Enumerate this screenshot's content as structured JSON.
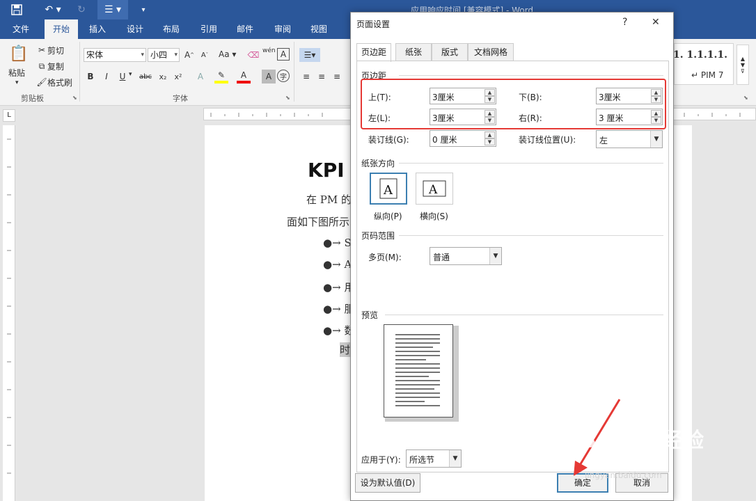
{
  "window": {
    "title": "应用响应时间 [兼容模式] - Word"
  },
  "quick_access": {
    "save_icon": "save-icon",
    "undo_icon": "undo-icon",
    "redo_icon": "redo-icon",
    "list_icon": "bullet-list-icon"
  },
  "ribbon_tabs": [
    "文件",
    "开始",
    "插入",
    "设计",
    "布局",
    "引用",
    "邮件",
    "审阅",
    "视图"
  ],
  "ribbon": {
    "clipboard": {
      "label": "剪贴板",
      "paste": "粘贴",
      "cut": "剪切",
      "copy": "复制",
      "format_painter": "格式刷"
    },
    "font": {
      "label": "字体",
      "font_name": "宋体",
      "font_size": "小四",
      "aa": "Aa",
      "wen": "wén",
      "a_box": "A"
    },
    "styles": {
      "style1": "1.  1.1.1.1.",
      "style2": "↵ PIM 7"
    }
  },
  "document": {
    "heading": "KPI",
    "line1": "在 PM 的",
    "line2": "面如下图所示",
    "bullets": [
      "Se",
      "Av",
      "用",
      "服",
      "数"
    ],
    "last": "时"
  },
  "dialog": {
    "title": "页面设置",
    "help": "?",
    "close": "✕",
    "tabs": [
      "页边距",
      "纸张",
      "版式",
      "文档网格"
    ],
    "margins_section": "页边距",
    "top_label": "上(T):",
    "top_value": "3厘米",
    "bottom_label": "下(B):",
    "bottom_value": "3厘米",
    "left_label": "左(L):",
    "left_value": "3厘米",
    "right_label": "右(R):",
    "right_value": "3 厘米",
    "gutter_label": "装订线(G):",
    "gutter_value": "0 厘米",
    "gutter_pos_label": "装订线位置(U):",
    "gutter_pos_value": "左",
    "orientation_section": "纸张方向",
    "portrait": "纵向(P)",
    "landscape": "横向(S)",
    "pages_section": "页码范围",
    "multiple_pages_label": "多页(M):",
    "multiple_pages_value": "普通",
    "preview_section": "预览",
    "apply_to_label": "应用于(Y):",
    "apply_to_value": "所选节",
    "set_default": "设为默认值(D)",
    "ok": "确定",
    "cancel": "取消"
  },
  "watermark": {
    "brand": "Bai du 经验",
    "url": "jingyan.baidu.com"
  }
}
